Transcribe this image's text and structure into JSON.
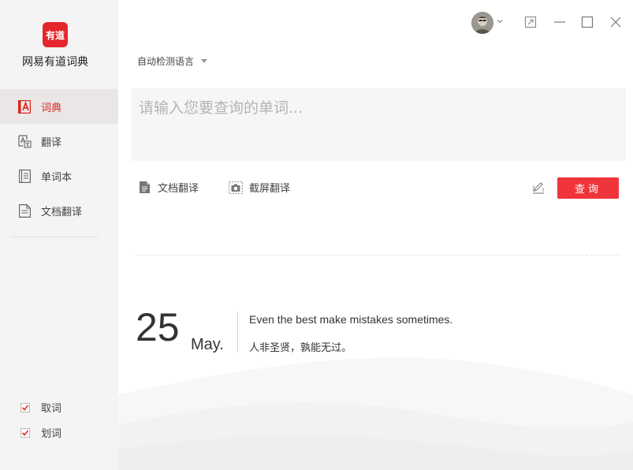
{
  "sidebar": {
    "logo_text": "有道",
    "app_name": "网易有道词典",
    "nav": [
      {
        "label": "词典",
        "icon": "dictionary-icon",
        "active": true
      },
      {
        "label": "翻译",
        "icon": "translate-icon",
        "active": false
      },
      {
        "label": "单词本",
        "icon": "wordbook-icon",
        "active": false
      },
      {
        "label": "文档翻译",
        "icon": "document-translate-icon",
        "active": false
      }
    ],
    "options": [
      {
        "label": "取词",
        "checked": true
      },
      {
        "label": "划词",
        "checked": true
      }
    ]
  },
  "titlebar": {
    "avatar_icon": "user-avatar",
    "controls": [
      "pin-icon",
      "minimize-icon",
      "maximize-icon",
      "close-icon"
    ]
  },
  "main": {
    "language_select": "自动检测语言",
    "search_placeholder": "请输入您要查询的单词...",
    "tools": {
      "doc_translate": "文档翻译",
      "screenshot_translate": "截屏翻译"
    },
    "query_button": "查询"
  },
  "daily": {
    "day": "25",
    "month": "May.",
    "quote_en": "Even the best make mistakes sometimes.",
    "quote_cn": "人非圣贤，孰能无过。"
  },
  "colors": {
    "accent": "#e4262d",
    "button": "#f0343b",
    "sidebar_bg": "#f4f4f4",
    "active_bg": "#ebe6e6"
  }
}
